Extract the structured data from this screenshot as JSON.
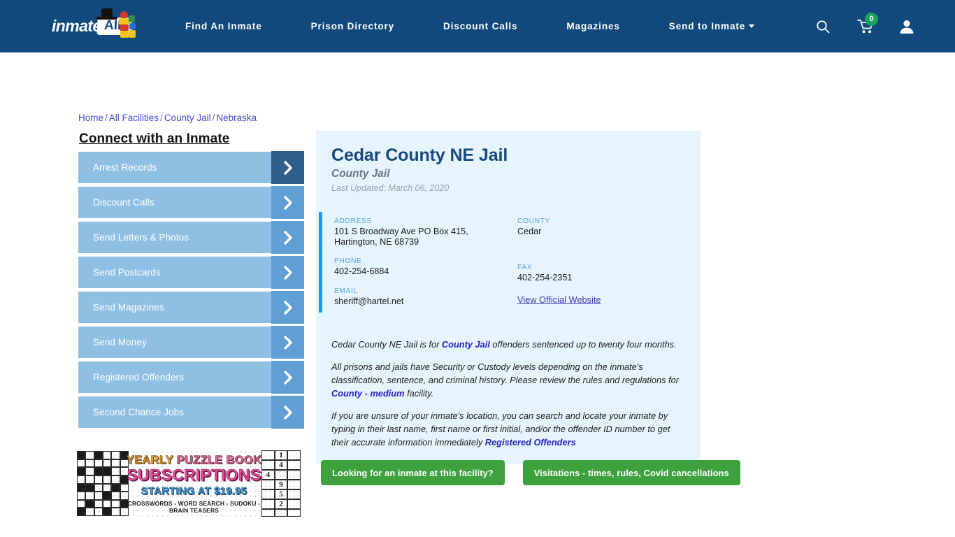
{
  "header": {
    "logo": {
      "word": "inmate",
      "bubble": "AID",
      "icons": [
        "top-hat-icon",
        "clown-figure-icon"
      ]
    },
    "nav": [
      {
        "label": "Find An Inmate",
        "has_dropdown": false
      },
      {
        "label": "Prison Directory",
        "has_dropdown": false
      },
      {
        "label": "Discount Calls",
        "has_dropdown": false
      },
      {
        "label": "Magazines",
        "has_dropdown": false
      },
      {
        "label": "Send to Inmate",
        "has_dropdown": true
      }
    ],
    "icons": {
      "search": "search-icon",
      "cart": "shopping-cart-icon",
      "cart_count": "0",
      "account": "user-account-icon"
    },
    "bg_color": "#11497c",
    "badge_color": "#1aa05f"
  },
  "breadcrumb": {
    "items": [
      "Home",
      "All Facilities",
      "County Jail",
      "Nebraska"
    ],
    "separator": "/"
  },
  "sidebar": {
    "title": "Connect with an Inmate",
    "items": [
      {
        "label": "Arrest Records",
        "active": true
      },
      {
        "label": "Discount Calls",
        "active": false
      },
      {
        "label": "Send Letters & Photos",
        "active": false
      },
      {
        "label": "Send Postcards",
        "active": false
      },
      {
        "label": "Send Magazines",
        "active": false
      },
      {
        "label": "Send Money",
        "active": false
      },
      {
        "label": "Registered Offenders",
        "active": false
      },
      {
        "label": "Second Chance Jobs",
        "active": false
      }
    ],
    "item_color": "#8fc0e4",
    "arrow_color": "#5f9fd4",
    "arrow_active_color": "#2f5f8a"
  },
  "ad": {
    "line1_a": "YEARLY ",
    "line1_b": "PUZZLE BOOK",
    "line2": "SUBSCRIPTIONS",
    "line3": "STARTING AT $19.95",
    "line4": "CROSSWORDS - WORD SEARCH - SUDOKU - BRAIN TEASERS",
    "sudoku_digits": [
      "",
      "1",
      "",
      "",
      "4",
      "",
      "4",
      "",
      "",
      "",
      "9",
      "",
      "",
      "5",
      "",
      "",
      "2",
      "",
      "",
      "",
      ""
    ]
  },
  "facility": {
    "name": "Cedar County NE Jail",
    "type": "County Jail",
    "last_updated": "Last Updated: March 06, 2020",
    "fields": {
      "address_label": "ADDRESS",
      "address_line1": "101 S Broadway Ave PO Box 415,",
      "address_line2": "Hartington, NE 68739",
      "phone_label": "PHONE",
      "phone": "402-254-6884",
      "email_label": "EMAIL",
      "email": "sheriff@hartel.net",
      "county_label": "COUNTY",
      "county": "Cedar",
      "fax_label": "FAX",
      "fax": "402-254-2351",
      "website_link": "View Official Website"
    },
    "paragraphs": {
      "p1_a": "Cedar County NE Jail is for ",
      "p1_link": "County Jail",
      "p1_b": " offenders sentenced up to twenty four months.",
      "p2_a": "All prisons and jails have Security or Custody levels depending on the inmate's classification, sentence, and criminal history. Please review the rules and regulations for ",
      "p2_link": "County - medium",
      "p2_b": " facility.",
      "p3_a": "If you are unsure of your inmate's location, you can search and locate your inmate by typing in their last name, first name or first initial, and/or the offender ID number to get their accurate information immediately ",
      "p3_link": "Registered Offenders"
    },
    "card_bg": "#e6f4fd",
    "accent_bar": "#2196f3",
    "title_color": "#17497f"
  },
  "buttons": [
    {
      "label": "Looking for an inmate at this facility?"
    },
    {
      "label": "Visitations - times, rules, Covid cancellations"
    }
  ],
  "button_color": "#3da13e"
}
